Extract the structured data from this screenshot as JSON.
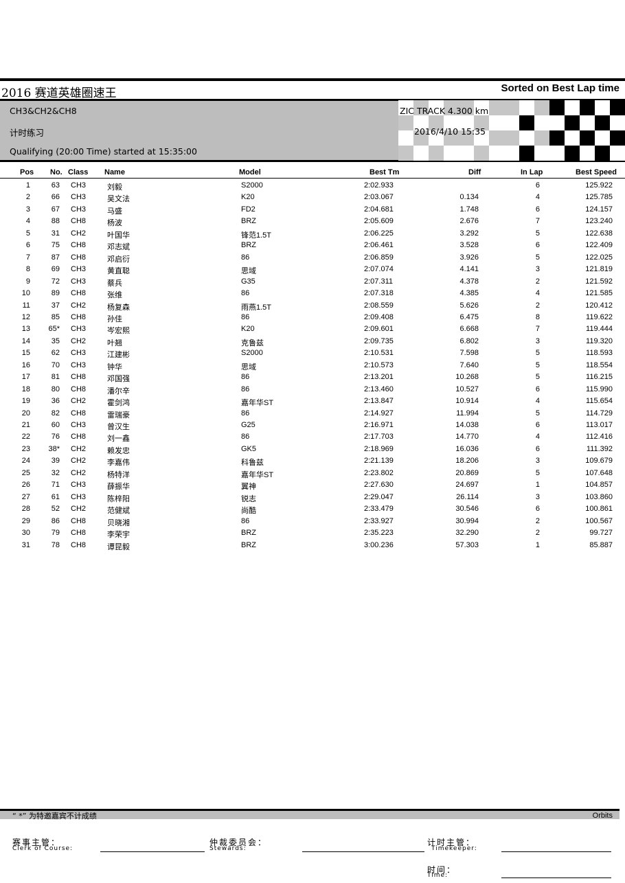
{
  "report": {
    "title": "2016 赛道英雄圈速王",
    "sort_label": "Sorted on Best Lap time",
    "classes": "CH3&CH2&CH8",
    "session": "计时练习",
    "track": "ZIC TRACK 4.300 km",
    "datetime": "2016/4/10 15:35",
    "started": "Qualifying (20:00 Time) started at 15:35:00"
  },
  "columns": {
    "pos": "Pos",
    "no": "No.",
    "class": "Class",
    "name": "Name",
    "model": "Model",
    "best": "Best Tm",
    "diff": "Diff",
    "inlap": "In Lap",
    "speed": "Best Speed"
  },
  "rows": [
    {
      "pos": "1",
      "no": "63",
      "cls": "CH3",
      "name": "刘毅",
      "model": "S2000",
      "best": "2:02.933",
      "diff": "",
      "lap": "6",
      "speed": "125.922"
    },
    {
      "pos": "2",
      "no": "66",
      "cls": "CH3",
      "name": "吴文法",
      "model": "K20",
      "best": "2:03.067",
      "diff": "0.134",
      "lap": "4",
      "speed": "125.785"
    },
    {
      "pos": "3",
      "no": "67",
      "cls": "CH3",
      "name": "马盛",
      "model": "FD2",
      "best": "2:04.681",
      "diff": "1.748",
      "lap": "6",
      "speed": "124.157"
    },
    {
      "pos": "4",
      "no": "88",
      "cls": "CH8",
      "name": "杨波",
      "model": "BRZ",
      "best": "2:05.609",
      "diff": "2.676",
      "lap": "7",
      "speed": "123.240"
    },
    {
      "pos": "5",
      "no": "31",
      "cls": "CH2",
      "name": "叶国华",
      "model": "锋范1.5T",
      "best": "2:06.225",
      "diff": "3.292",
      "lap": "5",
      "speed": "122.638"
    },
    {
      "pos": "6",
      "no": "75",
      "cls": "CH8",
      "name": "邓志斌",
      "model": "BRZ",
      "best": "2:06.461",
      "diff": "3.528",
      "lap": "6",
      "speed": "122.409"
    },
    {
      "pos": "7",
      "no": "87",
      "cls": "CH8",
      "name": "邓启衍",
      "model": "86",
      "best": "2:06.859",
      "diff": "3.926",
      "lap": "5",
      "speed": "122.025"
    },
    {
      "pos": "8",
      "no": "69",
      "cls": "CH3",
      "name": "黄直聪",
      "model": "思域",
      "best": "2:07.074",
      "diff": "4.141",
      "lap": "3",
      "speed": "121.819"
    },
    {
      "pos": "9",
      "no": "72",
      "cls": "CH3",
      "name": "蔡兵",
      "model": "G35",
      "best": "2:07.311",
      "diff": "4.378",
      "lap": "2",
      "speed": "121.592"
    },
    {
      "pos": "10",
      "no": "89",
      "cls": "CH8",
      "name": "张维",
      "model": "86",
      "best": "2:07.318",
      "diff": "4.385",
      "lap": "4",
      "speed": "121.585"
    },
    {
      "pos": "11",
      "no": "37",
      "cls": "CH2",
      "name": "杨复森",
      "model": "雨燕1.5T",
      "best": "2:08.559",
      "diff": "5.626",
      "lap": "2",
      "speed": "120.412"
    },
    {
      "pos": "12",
      "no": "85",
      "cls": "CH8",
      "name": "孙佳",
      "model": "86",
      "best": "2:09.408",
      "diff": "6.475",
      "lap": "8",
      "speed": "119.622"
    },
    {
      "pos": "13",
      "no": "65*",
      "cls": "CH3",
      "name": "岑宏熙",
      "model": "K20",
      "best": "2:09.601",
      "diff": "6.668",
      "lap": "7",
      "speed": "119.444"
    },
    {
      "pos": "14",
      "no": "35",
      "cls": "CH2",
      "name": "叶翘",
      "model": "克鲁兹",
      "best": "2:09.735",
      "diff": "6.802",
      "lap": "3",
      "speed": "119.320"
    },
    {
      "pos": "15",
      "no": "62",
      "cls": "CH3",
      "name": "江建彬",
      "model": "S2000",
      "best": "2:10.531",
      "diff": "7.598",
      "lap": "5",
      "speed": "118.593"
    },
    {
      "pos": "16",
      "no": "70",
      "cls": "CH3",
      "name": "钟华",
      "model": "思域",
      "best": "2:10.573",
      "diff": "7.640",
      "lap": "5",
      "speed": "118.554"
    },
    {
      "pos": "17",
      "no": "81",
      "cls": "CH8",
      "name": "邓国强",
      "model": "86",
      "best": "2:13.201",
      "diff": "10.268",
      "lap": "5",
      "speed": "116.215"
    },
    {
      "pos": "18",
      "no": "80",
      "cls": "CH8",
      "name": "潘尔辛",
      "model": "86",
      "best": "2:13.460",
      "diff": "10.527",
      "lap": "6",
      "speed": "115.990"
    },
    {
      "pos": "19",
      "no": "36",
      "cls": "CH2",
      "name": "霍剑鸿",
      "model": "嘉年华ST",
      "best": "2:13.847",
      "diff": "10.914",
      "lap": "4",
      "speed": "115.654"
    },
    {
      "pos": "20",
      "no": "82",
      "cls": "CH8",
      "name": "雷瑞豪",
      "model": "86",
      "best": "2:14.927",
      "diff": "11.994",
      "lap": "5",
      "speed": "114.729"
    },
    {
      "pos": "21",
      "no": "60",
      "cls": "CH3",
      "name": "曾汉生",
      "model": "G25",
      "best": "2:16.971",
      "diff": "14.038",
      "lap": "6",
      "speed": "113.017"
    },
    {
      "pos": "22",
      "no": "76",
      "cls": "CH8",
      "name": "刘一鑫",
      "model": "86",
      "best": "2:17.703",
      "diff": "14.770",
      "lap": "4",
      "speed": "112.416"
    },
    {
      "pos": "23",
      "no": "38*",
      "cls": "CH2",
      "name": "赖发忠",
      "model": "GK5",
      "best": "2:18.969",
      "diff": "16.036",
      "lap": "6",
      "speed": "111.392"
    },
    {
      "pos": "24",
      "no": "39",
      "cls": "CH2",
      "name": "李嘉伟",
      "model": "科鲁兹",
      "best": "2:21.139",
      "diff": "18.206",
      "lap": "3",
      "speed": "109.679"
    },
    {
      "pos": "25",
      "no": "32",
      "cls": "CH2",
      "name": "杨特洋",
      "model": "嘉年华ST",
      "best": "2:23.802",
      "diff": "20.869",
      "lap": "5",
      "speed": "107.648"
    },
    {
      "pos": "26",
      "no": "71",
      "cls": "CH3",
      "name": "薛振华",
      "model": "翼神",
      "best": "2:27.630",
      "diff": "24.697",
      "lap": "1",
      "speed": "104.857"
    },
    {
      "pos": "27",
      "no": "61",
      "cls": "CH3",
      "name": "陈梓阳",
      "model": "锐志",
      "best": "2:29.047",
      "diff": "26.114",
      "lap": "3",
      "speed": "103.860"
    },
    {
      "pos": "28",
      "no": "52",
      "cls": "CH2",
      "name": "范健斌",
      "model": "尚酷",
      "best": "2:33.479",
      "diff": "30.546",
      "lap": "6",
      "speed": "100.861"
    },
    {
      "pos": "29",
      "no": "86",
      "cls": "CH8",
      "name": "贝晓湘",
      "model": "86",
      "best": "2:33.927",
      "diff": "30.994",
      "lap": "2",
      "speed": "100.567"
    },
    {
      "pos": "30",
      "no": "79",
      "cls": "CH8",
      "name": "李荣宇",
      "model": "BRZ",
      "best": "2:35.223",
      "diff": "32.290",
      "lap": "2",
      "speed": "99.727"
    },
    {
      "pos": "31",
      "no": "78",
      "cls": "CH8",
      "name": "谭昆毅",
      "model": "BRZ",
      "best": "3:00.236",
      "diff": "57.303",
      "lap": "1",
      "speed": "85.887"
    }
  ],
  "footer": {
    "note": "“ *” 为特邀嘉宾不计成绩",
    "brand": "Orbits",
    "clerk_cn": "赛事主管：",
    "clerk_en": "Clerk of Course:",
    "stewards_cn": "仲裁委员会：",
    "stewards_en": "Stewards:",
    "timekeeper_cn": "计时主管：",
    "timekeeper_en": "Timekeeper:",
    "time_cn": "时间：",
    "time_en": "Time:"
  },
  "colors": {
    "band_gray": "#bdbdbd",
    "checker_gray": "#c6c6c6",
    "checker_white": "#ffffff",
    "checker_black": "#000000"
  }
}
